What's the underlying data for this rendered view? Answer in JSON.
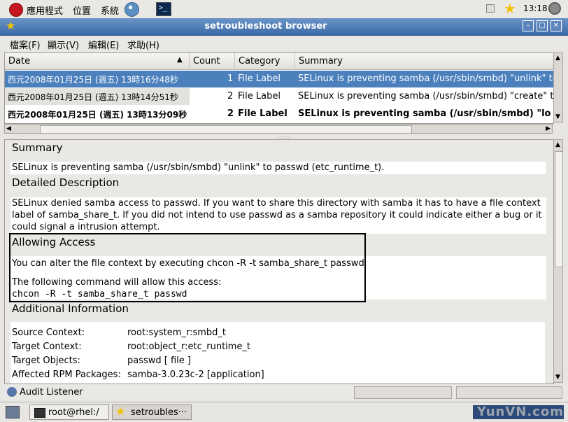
{
  "top_panel": {
    "menus": [
      "應用程式",
      "位置",
      "系統"
    ],
    "clock": "13:18"
  },
  "window": {
    "title": "setroubleshoot browser",
    "controls": {
      "minimize": "–",
      "maximize": "□",
      "close": "✕"
    }
  },
  "menubar": [
    "檔案(F)",
    "顯示(V)",
    "編輯(E)",
    "求助(H)"
  ],
  "table": {
    "columns": [
      "Date",
      "Count",
      "Category",
      "Summary"
    ],
    "sort_indicator": "▲",
    "rows": [
      {
        "date": "西元2008年01月25日 (週五) 13時16分48秒",
        "count": "1",
        "category": "File Label",
        "summary": "SELinux is preventing samba (/usr/sbin/smbd) \"unlink\" to",
        "selected": true,
        "bold": false
      },
      {
        "date": "西元2008年01月25日 (週五) 13時14分51秒",
        "count": "2",
        "category": "File Label",
        "summary": "SELinux is preventing samba (/usr/sbin/smbd) \"create\" to",
        "selected": false,
        "bold": false
      },
      {
        "date": "西元2008年01月25日 (週五) 13時13分09秒",
        "count": "2",
        "category": "File Label",
        "summary": "SELinux is preventing samba (/usr/sbin/smbd) \"lo",
        "selected": false,
        "bold": true
      }
    ]
  },
  "detail": {
    "summary_heading": "Summary",
    "summary_text": "SELinux is preventing samba (/usr/sbin/smbd) \"unlink\" to passwd (etc_runtime_t).",
    "description_heading": "Detailed Description",
    "description_lines": [
      "SELinux denied samba access to passwd. If you want to share this directory with samba it has to have a file context",
      "label of samba_share_t. If you did not intend to use passwd as a samba repository it could indicate either a bug or it",
      "could signal a intrusion attempt."
    ],
    "access_heading": "Allowing Access",
    "access_text": "You can alter the file context by executing chcon -R -t samba_share_t passwd",
    "command_intro": "The following command will allow this access:",
    "command": "chcon -R -t samba_share_t passwd",
    "additional_heading": "Additional Information",
    "info": [
      {
        "label": "Source Context:",
        "value": "root:system_r:smbd_t"
      },
      {
        "label": "Target Context:",
        "value": "root:object_r:etc_runtime_t"
      },
      {
        "label": "Target Objects:",
        "value": "passwd [ file ]"
      },
      {
        "label": "Affected RPM Packages:",
        "value": "samba-3.0.23c-2 [application]"
      }
    ]
  },
  "statusbar": {
    "text": "Audit Listener"
  },
  "taskbar": {
    "tasks": [
      "root@rhel:/",
      "setroubles···"
    ],
    "watermark": "YunVN.com"
  }
}
